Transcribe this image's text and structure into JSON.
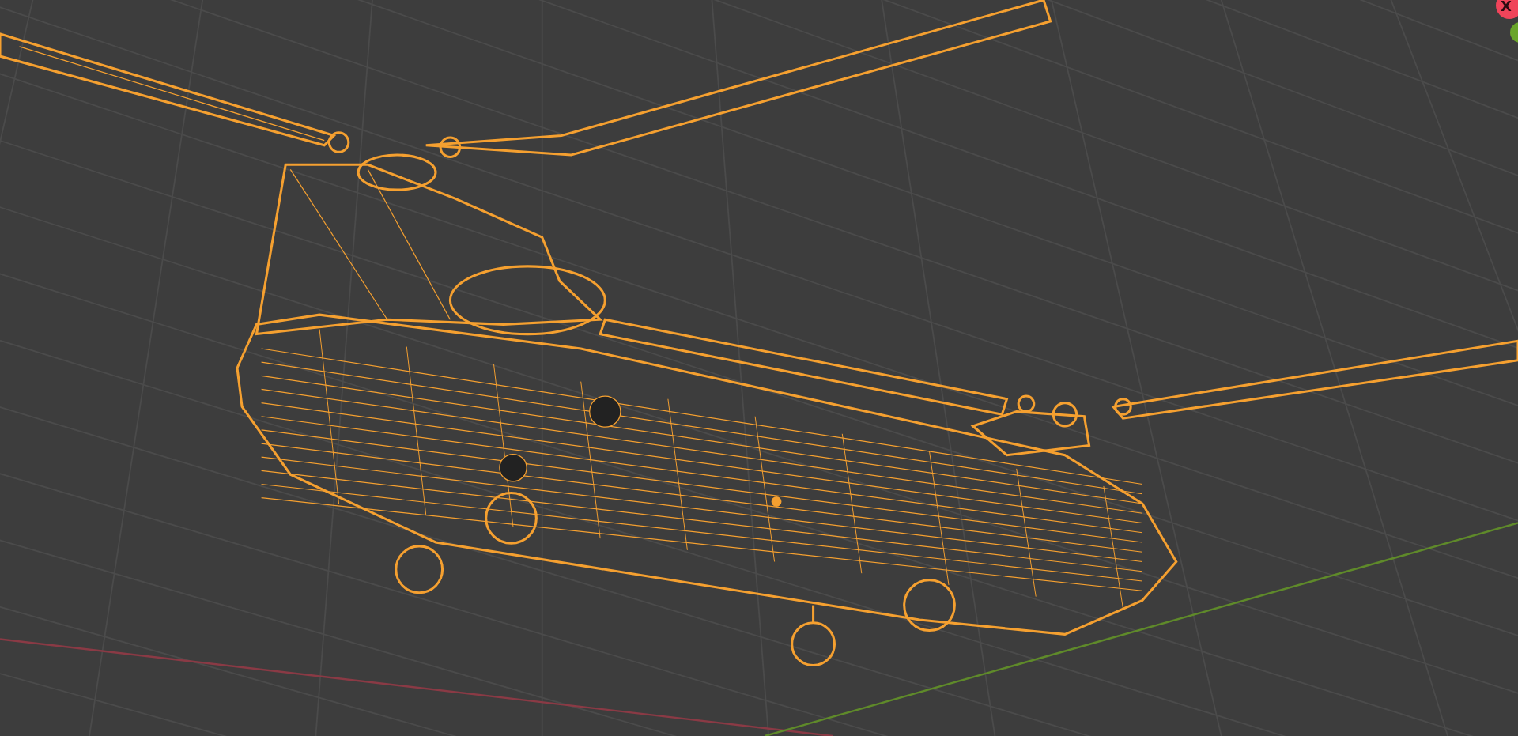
{
  "viewport": {
    "gizmo": {
      "x_label": "X"
    }
  }
}
